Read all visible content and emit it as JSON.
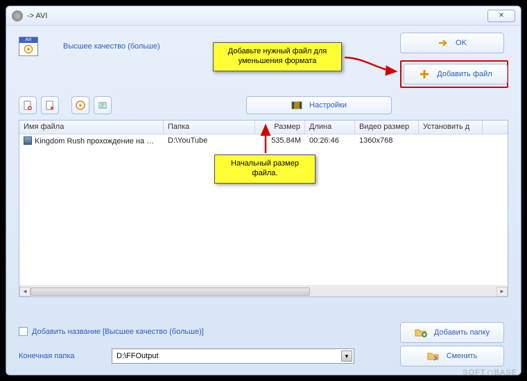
{
  "window": {
    "title": "-> AVI"
  },
  "top": {
    "avi_label": "AVI",
    "quality_link": "Высшее качество (больше)",
    "ok_label": "OK",
    "add_file_label": "Добавить файл",
    "settings_label": "Настройки"
  },
  "callouts": {
    "add_file": "Добавьте нужный файл для\nуменьшения формата",
    "size": "Начальный размер\nфайла."
  },
  "table": {
    "headers": [
      "Имя файла",
      "Папка",
      "Размер",
      "Длина",
      "Видео размер",
      "Установить д"
    ],
    "rows": [
      {
        "name": "Kingdom Rush прохождение на ПК ...",
        "folder": "D:\\YouTube",
        "size": "535.84M",
        "length": "00:26:46",
        "video_size": "1360x768",
        "set": ""
      }
    ]
  },
  "bottom": {
    "add_title_label": "Добавить название [Высшее качество (больше)]",
    "add_folder_label": "Добавить папку",
    "output_label": "Конечная папка",
    "output_value": "D:\\FFOutput",
    "change_label": "Сменить"
  },
  "watermark": "SOFT   BASE",
  "colors": {
    "accent": "#2a5bbd",
    "callout_bg": "#ffff33",
    "highlight_border": "#d40000"
  }
}
